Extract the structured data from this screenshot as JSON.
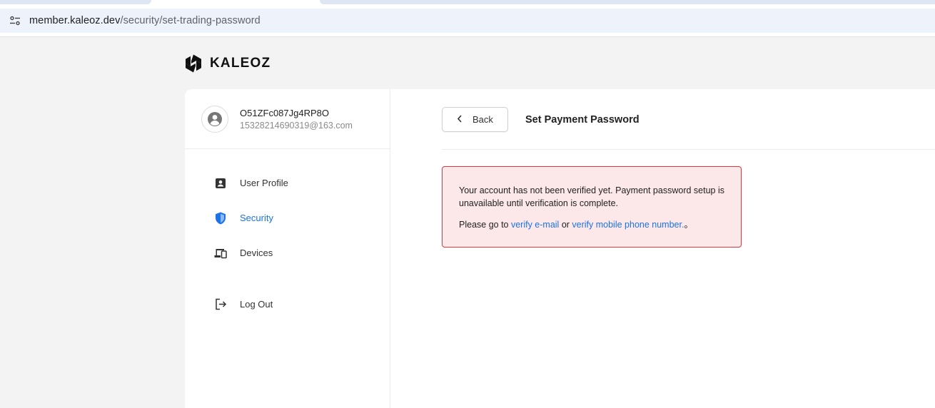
{
  "browser": {
    "url_host": "member.kaleoz.dev",
    "url_path": "/security/set-trading-password"
  },
  "brand": {
    "name": "KALEOZ"
  },
  "user": {
    "id": "O51ZFc087Jg4RP8O",
    "email": "15328214690319@163.com"
  },
  "sidebar": {
    "items": [
      {
        "label": "User Profile",
        "icon": "user-card-icon"
      },
      {
        "label": "Security",
        "icon": "shield-icon",
        "active": true
      },
      {
        "label": "Devices",
        "icon": "devices-icon"
      },
      {
        "label": "Log Out",
        "icon": "logout-icon"
      }
    ]
  },
  "main": {
    "back_label": "Back",
    "title": "Set Payment Password",
    "alert": {
      "message": "Your account has not been verified yet. Payment password setup is unavailable until verification is complete.",
      "prefix": "Please go to ",
      "link_email": "verify e-mail",
      "connector": " or ",
      "link_phone": "verify mobile phone number.",
      "suffix": "。"
    }
  },
  "colors": {
    "accent": "#1a73e8",
    "alert_bg": "#fde8e9",
    "alert_border": "#e0353b"
  }
}
